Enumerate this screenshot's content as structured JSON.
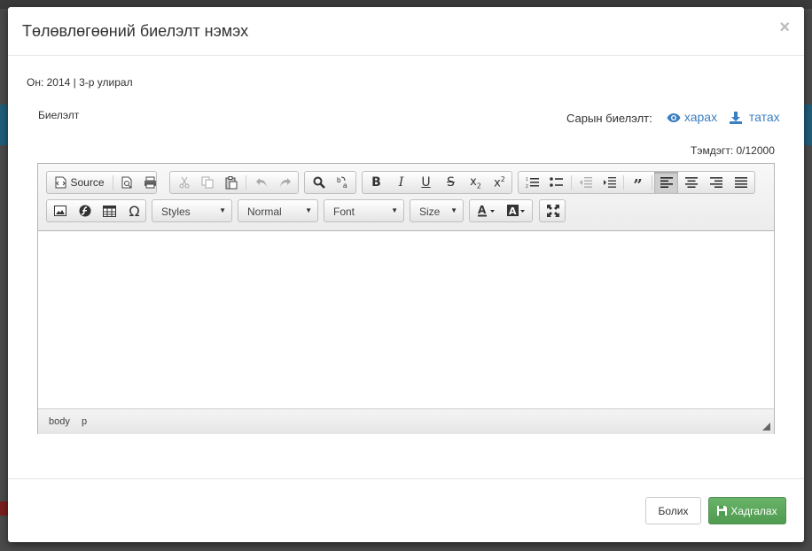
{
  "modal": {
    "title": "Төлөвлөгөөний биелэлт нэмэх",
    "close_label": "×"
  },
  "period_text": "Он: 2014 | 3-р улирал",
  "field_label": "Биелэлт",
  "monthly": {
    "label": "Сарын биелэлт:",
    "view_link": "харах",
    "download_link": "татах"
  },
  "char_counter": "Тэмдэгт: 0/12000",
  "editor": {
    "source_label": "Source",
    "combos": {
      "styles": "Styles",
      "format": "Normal",
      "font": "Font",
      "size": "Size"
    },
    "path": [
      "body",
      "p"
    ],
    "content": ""
  },
  "footer": {
    "cancel_label": "Болих",
    "save_label": "Хадгалах"
  },
  "colors": {
    "link": "#3a7fc1",
    "save_button": "#5cb85c",
    "backdrop": "#4a4a4a"
  }
}
